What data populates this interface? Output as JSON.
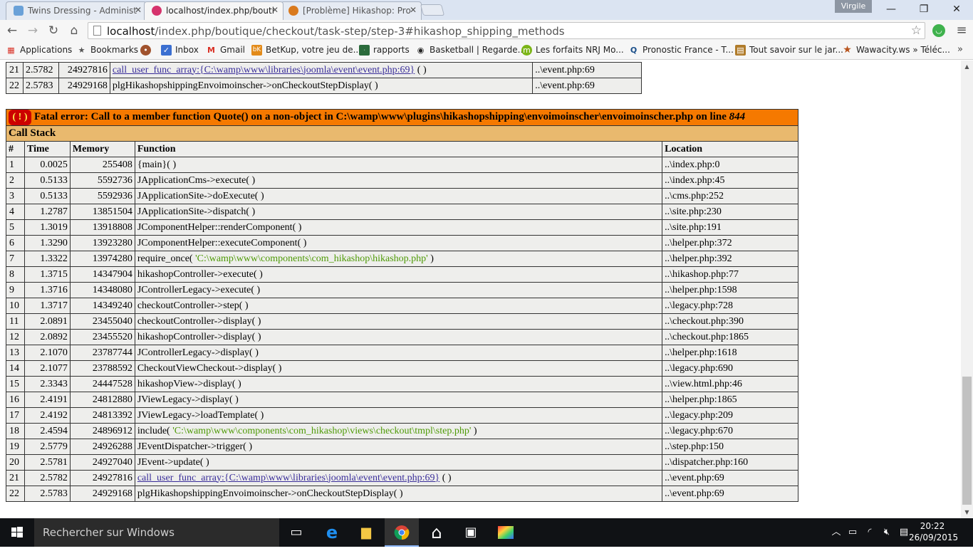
{
  "browser": {
    "tabs": [
      {
        "title": "Twins Dressing - Administ",
        "icon": "joomla-admin-icon",
        "favicon_color": "#6aa1d8"
      },
      {
        "title": "localhost/index.php/bouti",
        "icon": "page-favicon-icon",
        "favicon_color": "#d6336c"
      },
      {
        "title": "[Problème] Hikashop: Pro",
        "icon": "forum-favicon-icon",
        "favicon_color": "#d97a1e"
      }
    ],
    "user": "Virgile",
    "url_host": "localhost",
    "url_path": "/index.php/boutique/checkout/task-step/step-3#hikashop_shipping_methods",
    "bookmarks": [
      {
        "label": "Applications",
        "icon": "apps-grid-icon",
        "color": "#d93025"
      },
      {
        "label": "Bookmarks",
        "icon": "star-icon",
        "color": "#555555"
      },
      {
        "label": "",
        "icon": "cookie-icon",
        "color": "#a0522d"
      },
      {
        "label": "Inbox",
        "icon": "inbox-icon",
        "color": "#3b6fd1"
      },
      {
        "label": "Gmail",
        "icon": "gmail-icon",
        "color": "#d93025"
      },
      {
        "label": "BetKup, votre jeu de...",
        "icon": "betkup-icon",
        "color": "#e38b1a"
      },
      {
        "label": "rapports",
        "icon": "rapports-icon",
        "color": "#2b6b3c"
      },
      {
        "label": "Basketball | Regarde...",
        "icon": "basketball-icon",
        "color": "#222222"
      },
      {
        "label": "Les forfaits NRJ Mo...",
        "icon": "nrj-icon",
        "color": "#7cb518"
      },
      {
        "label": "Pronostic France - T...",
        "icon": "pronostic-icon",
        "color": "#1b4f8a"
      },
      {
        "label": "Tout savoir sur le jar...",
        "icon": "jardin-icon",
        "color": "#b07b2a"
      },
      {
        "label": "Wawacity.ws » Téléc...",
        "icon": "wawacity-star-icon",
        "color": "#b8531b"
      }
    ]
  },
  "top_rows": [
    {
      "n": "21",
      "time": "2.5782",
      "memory": "24927816",
      "func_link": "call_user_func_array:{C:\\wamp\\www\\libraries\\joomla\\event\\event.php:69}",
      "func_rest": " ( )",
      "location": "..\\event.php:69"
    },
    {
      "n": "22",
      "time": "2.5783",
      "memory": "24929168",
      "func_link": "",
      "func_rest": "plgHikashopshippingEnvoimoinscher->onCheckoutStepDisplay( )",
      "location": "..\\event.php:69"
    }
  ],
  "error": {
    "bang": "( ! )",
    "prefix": "Fatal error: Call to a member function Quote() on a non-object in C:\\wamp\\www\\plugins\\hikashopshipping\\envoimoinscher\\envoimoinscher.php on line ",
    "line": "844",
    "call_stack_label": "Call Stack",
    "columns": [
      "#",
      "Time",
      "Memory",
      "Function",
      "Location"
    ],
    "rows": [
      {
        "n": "1",
        "time": "0.0025",
        "memory": "255408",
        "func": "{main}( )",
        "arg": "",
        "after": "",
        "link": "",
        "location": "..\\index.php:0"
      },
      {
        "n": "2",
        "time": "0.5133",
        "memory": "5592736",
        "func": "JApplicationCms->execute( )",
        "arg": "",
        "after": "",
        "link": "",
        "location": "..\\index.php:45"
      },
      {
        "n": "3",
        "time": "0.5133",
        "memory": "5592936",
        "func": "JApplicationSite->doExecute( )",
        "arg": "",
        "after": "",
        "link": "",
        "location": "..\\cms.php:252"
      },
      {
        "n": "4",
        "time": "1.2787",
        "memory": "13851504",
        "func": "JApplicationSite->dispatch( )",
        "arg": "",
        "after": "",
        "link": "",
        "location": "..\\site.php:230"
      },
      {
        "n": "5",
        "time": "1.3019",
        "memory": "13918808",
        "func": "JComponentHelper::renderComponent( )",
        "arg": "",
        "after": "",
        "link": "",
        "location": "..\\site.php:191"
      },
      {
        "n": "6",
        "time": "1.3290",
        "memory": "13923280",
        "func": "JComponentHelper::executeComponent( )",
        "arg": "",
        "after": "",
        "link": "",
        "location": "..\\helper.php:372"
      },
      {
        "n": "7",
        "time": "1.3322",
        "memory": "13974280",
        "func": "require_once( ",
        "arg": "'C:\\wamp\\www\\components\\com_hikashop\\hikashop.php'",
        "after": " )",
        "link": "",
        "location": "..\\helper.php:392"
      },
      {
        "n": "8",
        "time": "1.3715",
        "memory": "14347904",
        "func": "hikashopController->execute( )",
        "arg": "",
        "after": "",
        "link": "",
        "location": "..\\hikashop.php:77"
      },
      {
        "n": "9",
        "time": "1.3716",
        "memory": "14348080",
        "func": "JControllerLegacy->execute( )",
        "arg": "",
        "after": "",
        "link": "",
        "location": "..\\helper.php:1598"
      },
      {
        "n": "10",
        "time": "1.3717",
        "memory": "14349240",
        "func": "checkoutController->step( )",
        "arg": "",
        "after": "",
        "link": "",
        "location": "..\\legacy.php:728"
      },
      {
        "n": "11",
        "time": "2.0891",
        "memory": "23455040",
        "func": "checkoutController->display( )",
        "arg": "",
        "after": "",
        "link": "",
        "location": "..\\checkout.php:390"
      },
      {
        "n": "12",
        "time": "2.0892",
        "memory": "23455520",
        "func": "hikashopController->display( )",
        "arg": "",
        "after": "",
        "link": "",
        "location": "..\\checkout.php:1865"
      },
      {
        "n": "13",
        "time": "2.1070",
        "memory": "23787744",
        "func": "JControllerLegacy->display( )",
        "arg": "",
        "after": "",
        "link": "",
        "location": "..\\helper.php:1618"
      },
      {
        "n": "14",
        "time": "2.1077",
        "memory": "23788592",
        "func": "CheckoutViewCheckout->display( )",
        "arg": "",
        "after": "",
        "link": "",
        "location": "..\\legacy.php:690"
      },
      {
        "n": "15",
        "time": "2.3343",
        "memory": "24447528",
        "func": "hikashopView->display( )",
        "arg": "",
        "after": "",
        "link": "",
        "location": "..\\view.html.php:46"
      },
      {
        "n": "16",
        "time": "2.4191",
        "memory": "24812880",
        "func": "JViewLegacy->display( )",
        "arg": "",
        "after": "",
        "link": "",
        "location": "..\\helper.php:1865"
      },
      {
        "n": "17",
        "time": "2.4192",
        "memory": "24813392",
        "func": "JViewLegacy->loadTemplate( )",
        "arg": "",
        "after": "",
        "link": "",
        "location": "..\\legacy.php:209"
      },
      {
        "n": "18",
        "time": "2.4594",
        "memory": "24896912",
        "func": "include( ",
        "arg": "'C:\\wamp\\www\\components\\com_hikashop\\views\\checkout\\tmpl\\step.php'",
        "after": " )",
        "link": "",
        "location": "..\\legacy.php:670"
      },
      {
        "n": "19",
        "time": "2.5779",
        "memory": "24926288",
        "func": "JEventDispatcher->trigger( )",
        "arg": "",
        "after": "",
        "link": "",
        "location": "..\\step.php:150"
      },
      {
        "n": "20",
        "time": "2.5781",
        "memory": "24927040",
        "func": "JEvent->update( )",
        "arg": "",
        "after": "",
        "link": "",
        "location": "..\\dispatcher.php:160"
      },
      {
        "n": "21",
        "time": "2.5782",
        "memory": "24927816",
        "func": "",
        "arg": "",
        "after": " ( )",
        "link": "call_user_func_array:{C:\\wamp\\www\\libraries\\joomla\\event\\event.php:69}",
        "location": "..\\event.php:69"
      },
      {
        "n": "22",
        "time": "2.5783",
        "memory": "24929168",
        "func": "plgHikashopshippingEnvoimoinscher->onCheckoutStepDisplay( )",
        "arg": "",
        "after": "",
        "link": "",
        "location": "..\\event.php:69"
      }
    ]
  },
  "taskbar": {
    "search_placeholder": "Rechercher sur Windows",
    "apps": [
      {
        "icon": "task-view-icon",
        "glyph": "▭"
      },
      {
        "icon": "edge-icon",
        "glyph": "e"
      },
      {
        "icon": "file-explorer-icon",
        "glyph": "▆"
      },
      {
        "icon": "chrome-icon",
        "glyph": "◉"
      },
      {
        "icon": "home-icon",
        "glyph": "⌂"
      },
      {
        "icon": "store-icon",
        "glyph": "▣"
      },
      {
        "icon": "color-app-icon",
        "glyph": "▦"
      }
    ],
    "time": "20:22",
    "date": "26/09/2015"
  }
}
